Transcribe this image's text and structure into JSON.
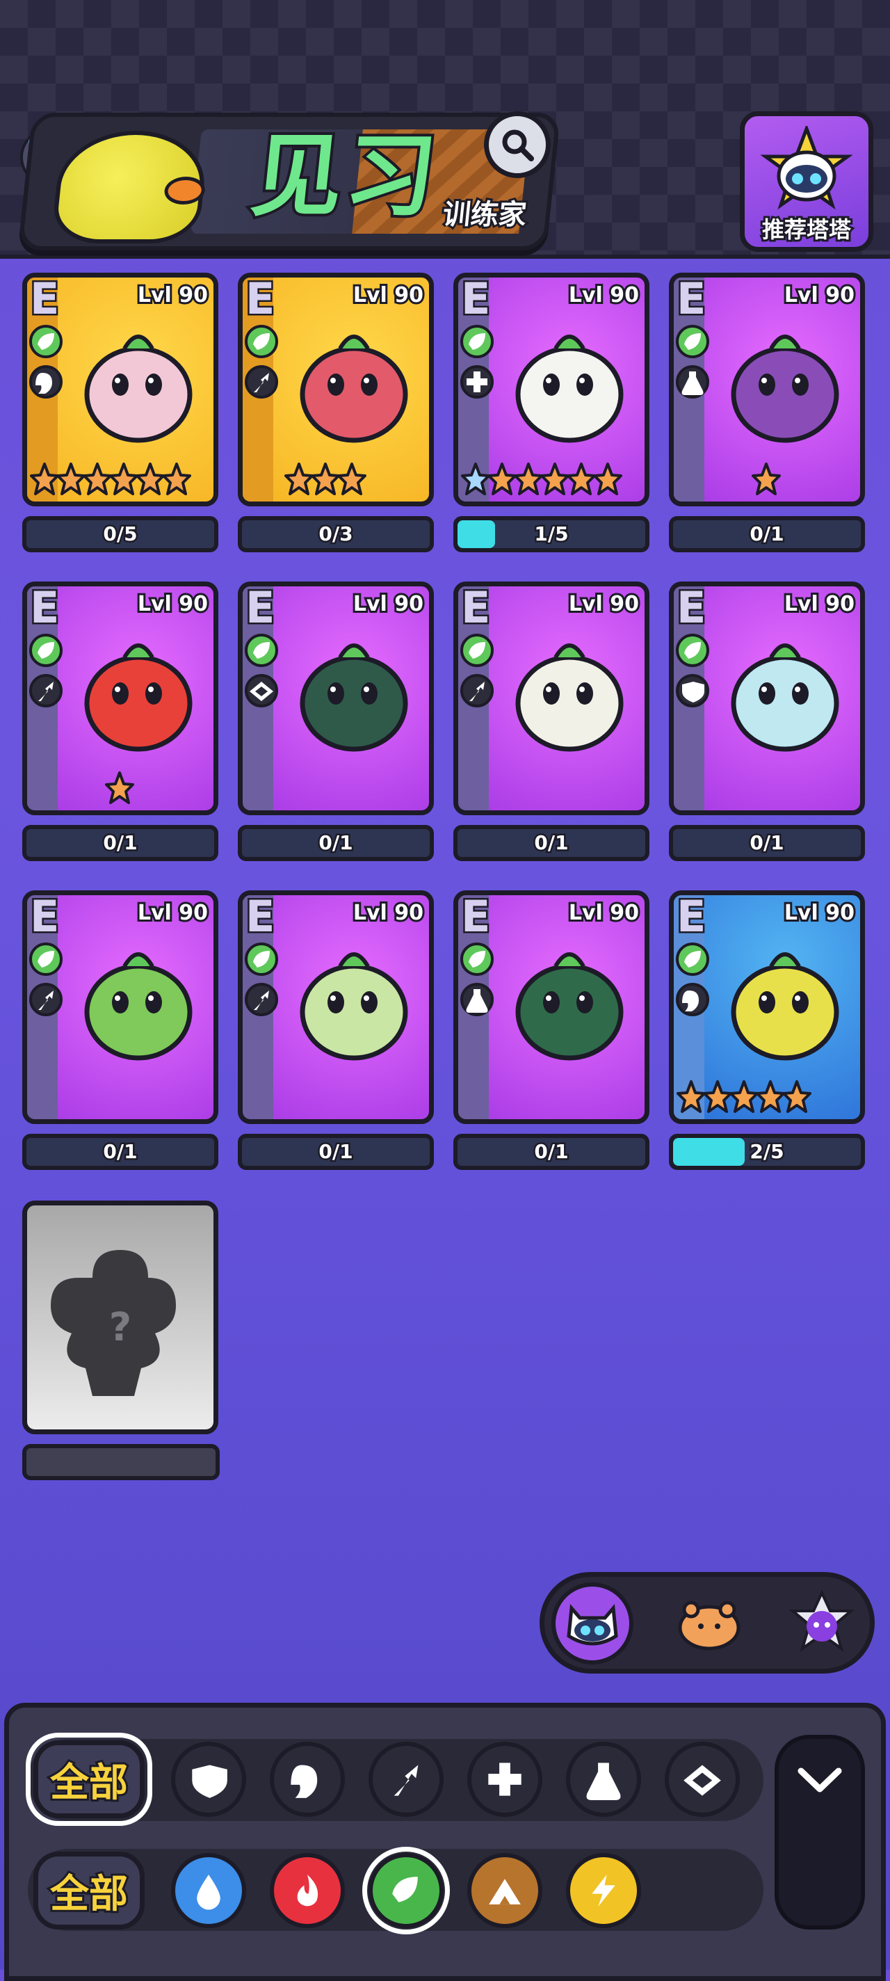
{
  "header": {
    "banner_title": "见习",
    "banner_subtitle": "训练家",
    "search_icon": "search-icon",
    "recommend_label": "推荐塔塔"
  },
  "cards": [
    {
      "rank": "E",
      "level": "Lvl 90",
      "element": "grass",
      "role": "speed",
      "bg": "gold",
      "stars": 6,
      "blue_stars": 0,
      "progress": "0/5",
      "fill": 0,
      "monster": "#f2c8d6"
    },
    {
      "rank": "E",
      "level": "Lvl 90",
      "element": "grass",
      "role": "attack",
      "bg": "gold",
      "stars": 3,
      "blue_stars": 0,
      "progress": "0/3",
      "fill": 0,
      "monster": "#e35a6a"
    },
    {
      "rank": "E",
      "level": "Lvl 90",
      "element": "grass",
      "role": "heal",
      "bg": "purple",
      "stars": 6,
      "blue_stars": 1,
      "progress": "1/5",
      "fill": 0.2,
      "monster": "#f4f4f0"
    },
    {
      "rank": "E",
      "level": "Lvl 90",
      "element": "grass",
      "role": "potion",
      "bg": "purple",
      "stars": 1,
      "blue_stars": 0,
      "progress": "0/1",
      "fill": 0,
      "monster": "#8a4db8"
    },
    {
      "rank": "E",
      "level": "Lvl 90",
      "element": "grass",
      "role": "attack",
      "bg": "purple",
      "stars": 1,
      "blue_stars": 0,
      "progress": "0/1",
      "fill": 0,
      "monster": "#e8413a"
    },
    {
      "rank": "E",
      "level": "Lvl 90",
      "element": "grass",
      "role": "eye",
      "bg": "purple",
      "stars": 0,
      "blue_stars": 0,
      "progress": "0/1",
      "fill": 0,
      "monster": "#2f5a4a"
    },
    {
      "rank": "E",
      "level": "Lvl 90",
      "element": "grass",
      "role": "attack",
      "bg": "purple",
      "stars": 0,
      "blue_stars": 0,
      "progress": "0/1",
      "fill": 0,
      "monster": "#f1f1e8"
    },
    {
      "rank": "E",
      "level": "Lvl 90",
      "element": "grass",
      "role": "shield",
      "bg": "purple",
      "stars": 0,
      "blue_stars": 0,
      "progress": "0/1",
      "fill": 0,
      "monster": "#bfe8f0"
    },
    {
      "rank": "E",
      "level": "Lvl 90",
      "element": "grass",
      "role": "attack",
      "bg": "purple",
      "stars": 0,
      "blue_stars": 0,
      "progress": "0/1",
      "fill": 0,
      "monster": "#7fca5a"
    },
    {
      "rank": "E",
      "level": "Lvl 90",
      "element": "grass",
      "role": "attack",
      "bg": "purple",
      "stars": 0,
      "blue_stars": 0,
      "progress": "0/1",
      "fill": 0,
      "monster": "#c9e6a4"
    },
    {
      "rank": "E",
      "level": "Lvl 90",
      "element": "grass",
      "role": "potion",
      "bg": "purple",
      "stars": 0,
      "blue_stars": 0,
      "progress": "0/1",
      "fill": 0,
      "monster": "#2f6b4a"
    },
    {
      "rank": "E",
      "level": "Lvl 90",
      "element": "grass",
      "role": "speed",
      "bg": "blue",
      "stars": 5,
      "blue_stars": 0,
      "progress": "2/5",
      "fill": 0.38,
      "monster": "#e8e04a"
    }
  ],
  "locked_card": {
    "symbol": "?"
  },
  "view_switch": [
    "cat-robot-icon",
    "bear-bun-icon",
    "star-badge-icon"
  ],
  "filters": {
    "all_label": "全部",
    "roles": [
      "shield-icon",
      "speed-icon",
      "attack-icon",
      "heal-icon",
      "potion-icon",
      "eye-icon"
    ],
    "elements": [
      {
        "name": "water-icon",
        "color": "#3c8ee8"
      },
      {
        "name": "fire-icon",
        "color": "#e8313f"
      },
      {
        "name": "grass-icon",
        "color": "#49b64b"
      },
      {
        "name": "earth-icon",
        "color": "#b7742c"
      },
      {
        "name": "electric-icon",
        "color": "#f2c324"
      }
    ],
    "collapse_icon": "chevron-down-icon"
  },
  "colors": {
    "accent_purple": "#9b4fe8",
    "progress_fill": "#3fdde6",
    "label_yellow": "#f7d23c"
  }
}
